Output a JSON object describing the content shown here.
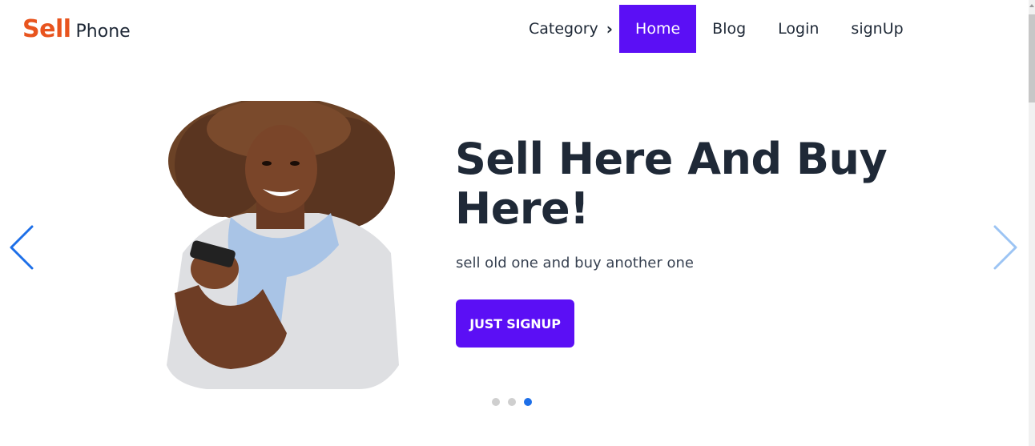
{
  "brand": {
    "name_primary": "Sell",
    "name_secondary": "Phone",
    "primary_color": "#e8541e"
  },
  "nav": {
    "category_label": "Category",
    "items": [
      {
        "label": "Home",
        "active": true
      },
      {
        "label": "Blog",
        "active": false
      },
      {
        "label": "Login",
        "active": false
      },
      {
        "label": "signUp",
        "active": false
      }
    ],
    "active_color": "#5b0ff5"
  },
  "hero": {
    "title": "Sell Here And Buy Here!",
    "subtitle": "sell old one and buy another one",
    "cta_label": "JUST SIGNUP",
    "image_subject": "woman-holding-phone"
  },
  "carousel": {
    "slide_count": 3,
    "active_index": 2,
    "prev_icon": "chevron-left-icon",
    "next_icon": "chevron-right-icon"
  }
}
